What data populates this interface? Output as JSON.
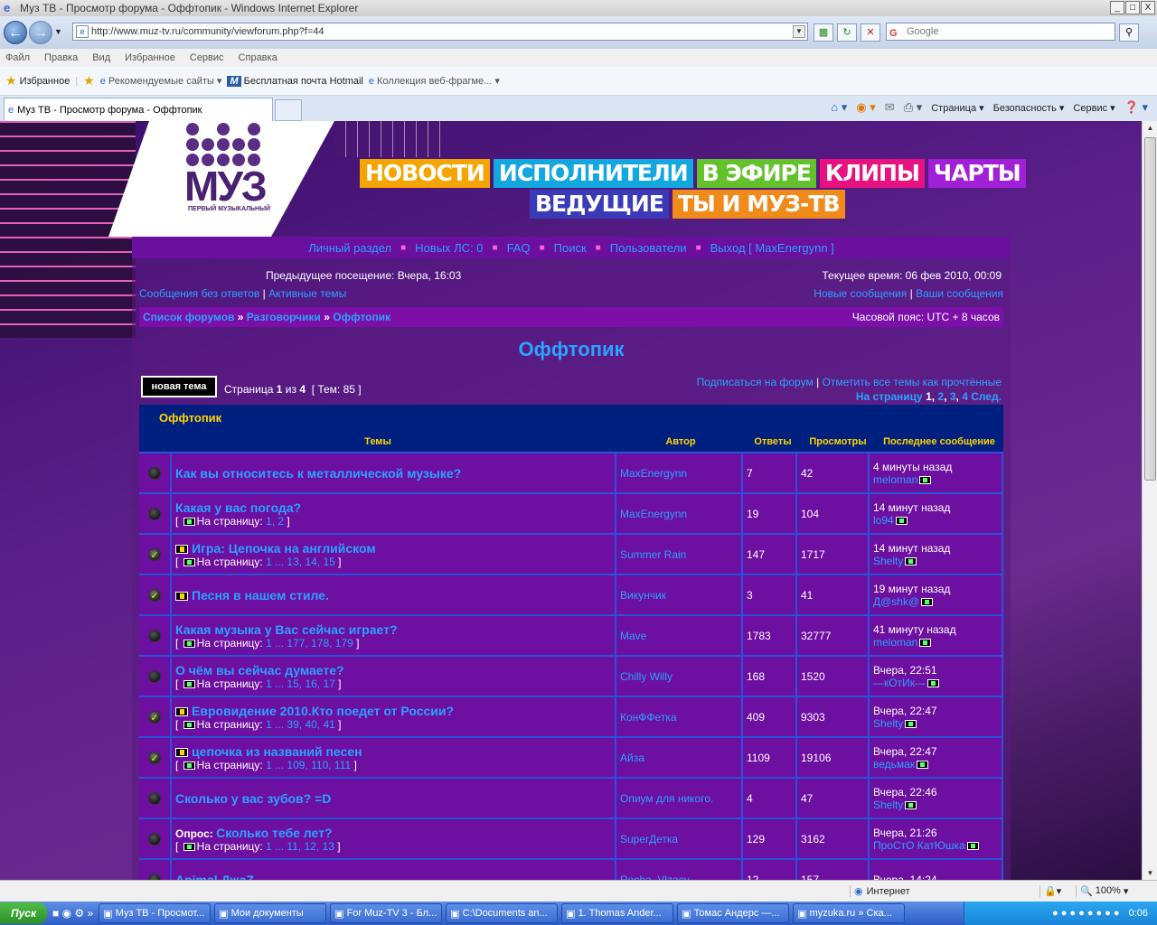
{
  "window": {
    "title": "Муз ТВ - Просмотр форума - Оффтопик - Windows Internet Explorer",
    "minimize": "_",
    "maximize": "□",
    "close": "X"
  },
  "address": {
    "url": "http://www.muz-tv.ru/community/viewforum.php?f=44",
    "search_placeholder": "Google"
  },
  "menu": [
    "Файл",
    "Правка",
    "Вид",
    "Избранное",
    "Сервис",
    "Справка"
  ],
  "favorites": {
    "label": "Избранное",
    "items": [
      "Рекомендуемые сайты",
      "Бесплатная почта Hotmail",
      "Коллекция веб-фрагме..."
    ]
  },
  "tab": {
    "label": "Муз ТВ - Просмотр форума - Оффтопик"
  },
  "cmd": {
    "page": "Страница",
    "security": "Безопасность",
    "service": "Сервис"
  },
  "site": {
    "logo_word": "МУЗ",
    "logo_sub": "ПЕРВЫЙ МУЗЫКАЛЬНЫЙ",
    "nav_row1": [
      {
        "label": "НОВОСТИ",
        "color": "#f5a400"
      },
      {
        "label": "ИСПОЛНИТЕЛИ",
        "color": "#13a7e0"
      },
      {
        "label": "В ЭФИРЕ",
        "color": "#63c22c"
      },
      {
        "label": "КЛИПЫ",
        "color": "#e7127f"
      },
      {
        "label": "ЧАРТЫ",
        "color": "#a11fd6"
      }
    ],
    "nav_row2": [
      {
        "label": "ВЕДУЩИЕ",
        "color": "#3a3ab8"
      },
      {
        "label": "ТЫ И МУЗ-ТВ",
        "color": "#f08a1a"
      }
    ]
  },
  "forum_nav": {
    "personal": "Личный раздел",
    "pm": "Новых ЛС: 0",
    "faq": "FAQ",
    "search": "Поиск",
    "users": "Пользователи",
    "logout": "Выход [ MaxEnergynn ]"
  },
  "info": {
    "last_visit": "Предыдущее посещение: Вчера, 16:03",
    "current_time": "Текущее время: 06 фев 2010, 00:09",
    "unanswered": "Сообщения без ответов",
    "active": "Активные темы",
    "new_posts": "Новые сообщения",
    "your_posts": "Ваши сообщения",
    "sep": "|"
  },
  "breadcrumb": {
    "index": "Список форумов",
    "cat": "Разговорчики",
    "forum": "Оффтопик",
    "arrow": "»",
    "timezone": "Часовой пояс: UTC + 8 часов"
  },
  "forum": {
    "title": "Оффтопик",
    "new_topic": "новая тема",
    "page_text": "Страница",
    "page_cur": "1",
    "page_of": "из",
    "page_total": "4",
    "topics_count": "[ Тем: 85 ]",
    "subscribe": "Подписаться на форум",
    "mark_read": "Отметить все темы как прочтённые",
    "goto_page": "На страницу",
    "pages": [
      "1",
      "2",
      "3",
      "4"
    ],
    "next": "След."
  },
  "table": {
    "caption": "Оффтопик",
    "headers": {
      "topics": "Темы",
      "author": "Автор",
      "replies": "Ответы",
      "views": "Просмотры",
      "last": "Последнее сообщение"
    },
    "pages_prefix": "На страницу:",
    "rows": [
      {
        "status": "read",
        "sticky": false,
        "title": "Как вы относитесь к металлической музыке?",
        "pages": "",
        "author": "MaxEnergynn",
        "replies": "7",
        "views": "42",
        "last_time": "4 минуты назад",
        "last_user": "meloman"
      },
      {
        "status": "read",
        "sticky": false,
        "title": "Какая у вас погода?",
        "pages": "1, 2",
        "author": "MaxEnergynn",
        "replies": "19",
        "views": "104",
        "last_time": "14 минут назад",
        "last_user": "lo94"
      },
      {
        "status": "posted",
        "sticky": true,
        "title": "Игра: Цепочка на английском",
        "pages": "1 ... 13, 14, 15",
        "author": "Summer Rain",
        "replies": "147",
        "views": "1717",
        "last_time": "14 минут назад",
        "last_user": "Shelty"
      },
      {
        "status": "posted",
        "sticky": true,
        "title": "Песня в нашем стиле.",
        "pages": "",
        "author": "Викунчик",
        "replies": "3",
        "views": "41",
        "last_time": "19 минут назад",
        "last_user": "Д@shk@"
      },
      {
        "status": "read",
        "sticky": false,
        "title": "Какая музыка у Вас сейчас играет?",
        "pages": "1 ... 177, 178, 179",
        "author": "Mave",
        "replies": "1783",
        "views": "32777",
        "last_time": "41 минуту назад",
        "last_user": "meloman"
      },
      {
        "status": "read",
        "sticky": false,
        "title": "О чём вы сейчас думаете?",
        "pages": "1 ... 15, 16, 17",
        "author": "Chilly Willy",
        "replies": "168",
        "views": "1520",
        "last_time": "Вчера, 22:51",
        "last_user": "—кОтИк—"
      },
      {
        "status": "posted",
        "sticky": true,
        "title": "Евровидение 2010.Кто поедет от России?",
        "pages": "1 ... 39, 40, 41",
        "author": "КонФФетка",
        "replies": "409",
        "views": "9303",
        "last_time": "Вчера, 22:47",
        "last_user": "Shelty"
      },
      {
        "status": "posted",
        "sticky": true,
        "title": "цепочка из названий песен",
        "pages": "1 ... 109, 110, 111",
        "author": "Айза",
        "replies": "1109",
        "views": "19106",
        "last_time": "Вчера, 22:47",
        "last_user": "ведьмак"
      },
      {
        "status": "read",
        "sticky": false,
        "title": "Сколько у вас зубов? =D",
        "pages": "",
        "author": "Опиум для никого.",
        "replies": "4",
        "views": "47",
        "last_time": "Вчера, 22:46",
        "last_user": "Shelty"
      },
      {
        "status": "read",
        "sticky": false,
        "poll": "Опрос:",
        "title": "Сколько тебе лет?",
        "pages": "1 ... 11, 12, 13",
        "author": "SuperДетка",
        "replies": "129",
        "views": "3162",
        "last_time": "Вчера, 21:26",
        "last_user": "ПроСтО КатЮшка"
      },
      {
        "status": "read",
        "sticky": false,
        "title": "Animal ДжаZ",
        "pages": "",
        "author": "Rocha_Vlzacy",
        "replies": "12",
        "views": "157",
        "last_time": "Вчера, 14:24",
        "last_user": ""
      }
    ]
  },
  "status": {
    "zone": "Интернет",
    "zoom": "100%"
  },
  "taskbar": {
    "start": "Пуск",
    "tasks": [
      "Муз ТВ - Просмот...",
      "Мои документы",
      "For Muz-TV 3 - Бл...",
      "C:\\Documents an...",
      "1. Thomas Ander...",
      "Томас Андерс —...",
      "myzuka.ru » Ска..."
    ],
    "clock": "0:06"
  }
}
